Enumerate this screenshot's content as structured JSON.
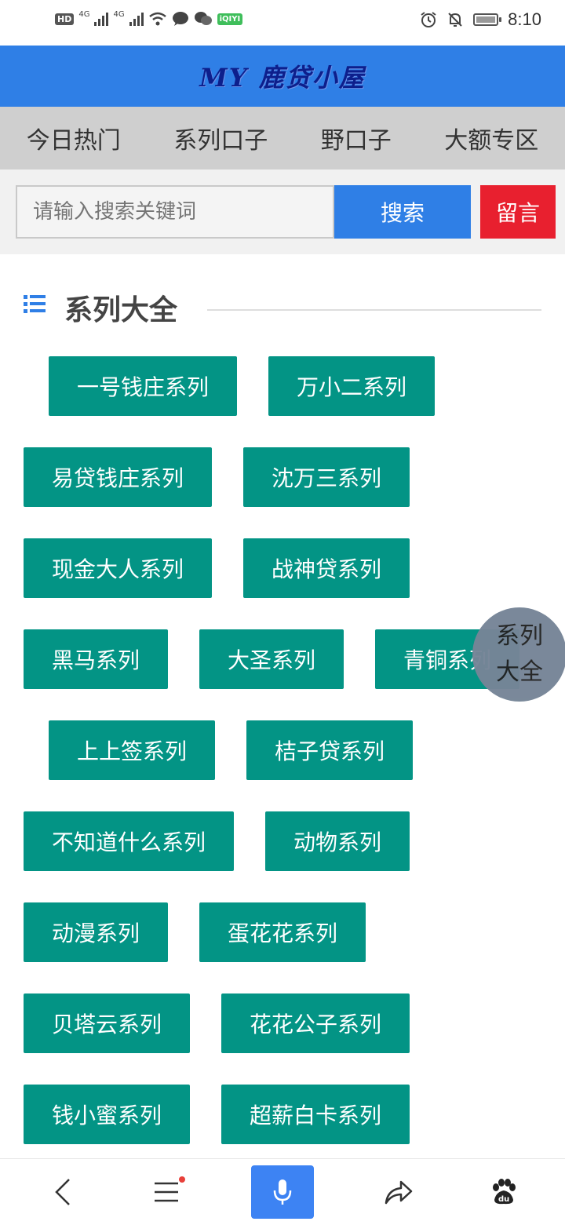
{
  "status_bar": {
    "hd_badge": "HD",
    "net1": "4G",
    "net2": "4G",
    "iqiyi": "iQIYI",
    "time": "8:10"
  },
  "header": {
    "logo_text": "MY 鹿贷小屋"
  },
  "nav": {
    "tabs": [
      "今日热门",
      "系列口子",
      "野口子",
      "大额专区"
    ]
  },
  "search": {
    "placeholder": "请输入搜索关键词",
    "search_label": "搜索",
    "message_label": "留言"
  },
  "section": {
    "title": "系列大全"
  },
  "tags": [
    "一号钱庄系列",
    "万小二系列",
    "易贷钱庄系列",
    "沈万三系列",
    "现金大人系列",
    "战神贷系列",
    "黑马系列",
    "大圣系列",
    "青铜系列",
    "上上签系列",
    "桔子贷系列",
    "不知道什么系列",
    "动物系列",
    "动漫系列",
    "蛋花花系列",
    "贝塔云系列",
    "花花公子系列",
    "钱小蜜系列",
    "超薪白卡系列"
  ],
  "float_button": {
    "line1": "系列",
    "line2": "大全"
  },
  "bottom_bar": {
    "icons": [
      "back-icon",
      "menu-icon",
      "microphone-icon",
      "share-icon",
      "baidu-paw-icon"
    ],
    "mic_color": "#3d83f3"
  },
  "colors": {
    "header_blue": "#2f7fe6",
    "tag_green": "#039485",
    "message_red": "#e8202f",
    "nav_gray": "#cfcfcf"
  }
}
